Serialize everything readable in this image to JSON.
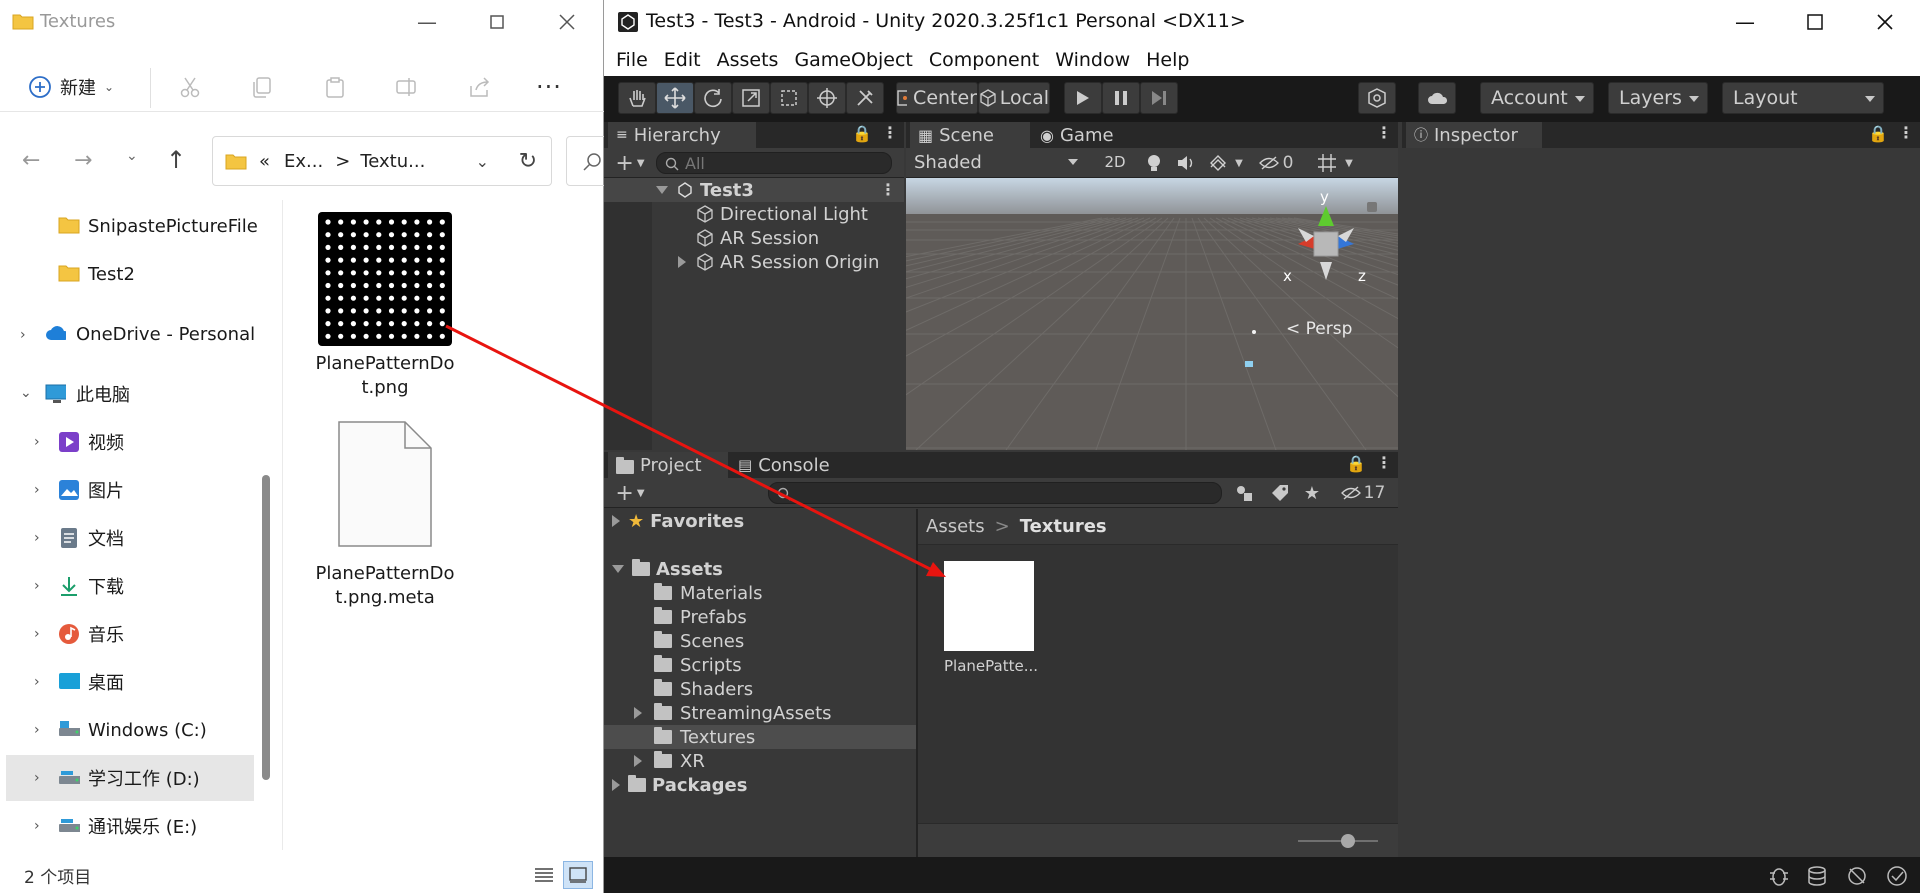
{
  "explorer": {
    "title": "Textures",
    "new_label": "新建",
    "address_prefix": "«",
    "address_seg1": "Ex...",
    "address_sep": ">",
    "address_seg2": "Textu...",
    "nav": [
      {
        "label": "SnipastePictureFile",
        "icon": "folder-icon"
      },
      {
        "label": "Test2",
        "icon": "folder-icon"
      },
      {
        "label": "OneDrive - Personal",
        "icon": "cloud-icon"
      },
      {
        "label": "此电脑",
        "icon": "computer-icon"
      },
      {
        "label": "视频",
        "icon": "video-icon"
      },
      {
        "label": "图片",
        "icon": "picture-icon"
      },
      {
        "label": "文档",
        "icon": "document-icon"
      },
      {
        "label": "下载",
        "icon": "download-icon"
      },
      {
        "label": "音乐",
        "icon": "music-icon"
      },
      {
        "label": "桌面",
        "icon": "desktop-icon"
      },
      {
        "label": "Windows  (C:)",
        "icon": "drive-icon"
      },
      {
        "label": "学习工作 (D:)",
        "icon": "drive-icon"
      },
      {
        "label": "通讯娱乐 (E:)",
        "icon": "drive-icon"
      }
    ],
    "files": [
      {
        "line1": "PlanePatternDo",
        "line2": "t.png"
      },
      {
        "line1": "PlanePatternDo",
        "line2": "t.png.meta"
      }
    ],
    "status": "2 个项目"
  },
  "unity": {
    "title": "Test3 - Test3 - Android - Unity 2020.3.25f1c1 Personal <DX11>",
    "menu": [
      "File",
      "Edit",
      "Assets",
      "GameObject",
      "Component",
      "Window",
      "Help"
    ],
    "toolbar": {
      "center": "Center",
      "local": "Local",
      "account": "Account",
      "layers": "Layers",
      "layout": "Layout"
    },
    "hierarchy": {
      "tab": "Hierarchy",
      "search_placeholder": "All",
      "scene": "Test3",
      "items": [
        "Directional Light",
        "AR Session",
        "AR Session Origin"
      ]
    },
    "scene": {
      "tab_scene": "Scene",
      "tab_game": "Game",
      "shading": "Shaded",
      "mode_2d": "2D",
      "hidden_count": "0",
      "persp": "< Persp",
      "axis_x": "x",
      "axis_y": "y",
      "axis_z": "z"
    },
    "inspector": {
      "tab": "Inspector"
    },
    "project": {
      "tab_project": "Project",
      "tab_console": "Console",
      "hidden_count": "17",
      "favorites": "Favorites",
      "assets": "Assets",
      "folders": [
        "Materials",
        "Prefabs",
        "Scenes",
        "Scripts",
        "Shaders",
        "StreamingAssets",
        "Textures",
        "XR"
      ],
      "packages": "Packages",
      "breadcrumb_root": "Assets",
      "breadcrumb_sep": ">",
      "breadcrumb_current": "Textures",
      "asset_label": "PlanePatte..."
    }
  },
  "colors": {
    "arrow": "#e8140f",
    "unity_bg": "#383838",
    "unity_toolbar": "#191919",
    "selected_row": "#4d4d4d",
    "explorer_selected": "#e6e6e6"
  }
}
